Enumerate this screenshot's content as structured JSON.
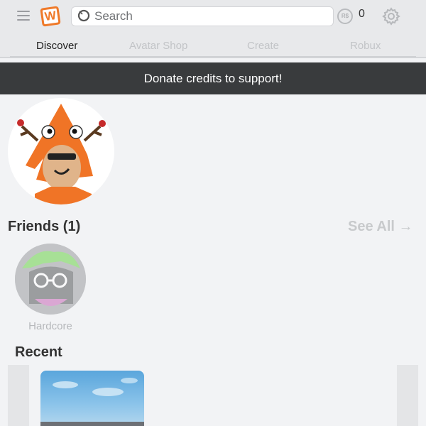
{
  "header": {
    "logo_letter": "W",
    "search_placeholder": "Search",
    "robux_symbol": "R$",
    "robux_count": "0"
  },
  "tabs": [
    {
      "label": "Discover",
      "active": true
    },
    {
      "label": "Avatar Shop",
      "active": false
    },
    {
      "label": "Create",
      "active": false
    },
    {
      "label": "Robux",
      "active": false
    }
  ],
  "banner": {
    "text": "Donate credits to support!"
  },
  "friends": {
    "title": "Friends (1)",
    "see_all": "See All →",
    "items": [
      {
        "name": "Hardcore"
      }
    ]
  },
  "recent": {
    "title": "Recent"
  },
  "colors": {
    "accent_orange": "#ef7a2a",
    "banner_bg": "#393b3d",
    "page_bg": "#f2f3f5"
  },
  "icons": [
    "menu-icon",
    "search-icon",
    "robux-icon",
    "gear-icon",
    "arrow-right-icon"
  ]
}
